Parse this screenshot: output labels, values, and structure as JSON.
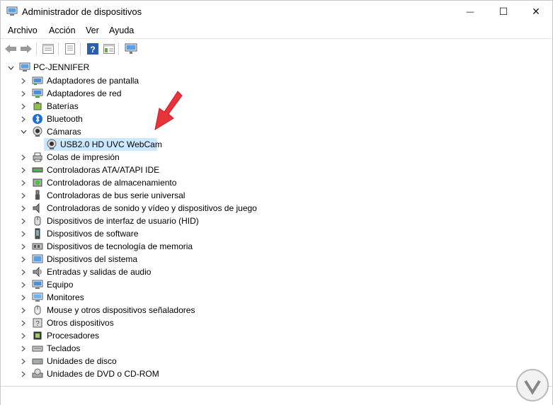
{
  "window": {
    "title": "Administrador de dispositivos",
    "minimize_glyph": "—",
    "maximize_glyph": "☐",
    "close_glyph": "✕"
  },
  "menu": {
    "file": "Archivo",
    "action": "Acción",
    "view": "Ver",
    "help": "Ayuda"
  },
  "tree": {
    "root": "PC-JENNIFER",
    "categories": [
      {
        "label": "Adaptadores de pantalla",
        "icon": "display-adapter-icon",
        "expanded": false
      },
      {
        "label": "Adaptadores de red",
        "icon": "network-adapter-icon",
        "expanded": false
      },
      {
        "label": "Baterías",
        "icon": "battery-icon",
        "expanded": false
      },
      {
        "label": "Bluetooth",
        "icon": "bluetooth-icon",
        "expanded": false
      },
      {
        "label": "Cámaras",
        "icon": "camera-icon",
        "expanded": true,
        "children": [
          {
            "label": "USB2.0 HD UVC WebCam",
            "icon": "webcam-icon",
            "selected": true
          }
        ]
      },
      {
        "label": "Colas de impresión",
        "icon": "printer-icon",
        "expanded": false
      },
      {
        "label": "Controladoras ATA/ATAPI IDE",
        "icon": "ide-controller-icon",
        "expanded": false
      },
      {
        "label": "Controladoras de almacenamiento",
        "icon": "storage-controller-icon",
        "expanded": false
      },
      {
        "label": "Controladoras de bus serie universal",
        "icon": "usb-icon",
        "expanded": false
      },
      {
        "label": "Controladoras de sonido y vídeo y dispositivos de juego",
        "icon": "speaker-icon",
        "expanded": false
      },
      {
        "label": "Dispositivos de interfaz de usuario (HID)",
        "icon": "hid-icon",
        "expanded": false
      },
      {
        "label": "Dispositivos de software",
        "icon": "software-device-icon",
        "expanded": false
      },
      {
        "label": "Dispositivos de tecnología de memoria",
        "icon": "memory-icon",
        "expanded": false
      },
      {
        "label": "Dispositivos del sistema",
        "icon": "system-device-icon",
        "expanded": false
      },
      {
        "label": "Entradas y salidas de audio",
        "icon": "audio-io-icon",
        "expanded": false
      },
      {
        "label": "Equipo",
        "icon": "computer-icon",
        "expanded": false
      },
      {
        "label": "Monitores",
        "icon": "monitor-icon",
        "expanded": false
      },
      {
        "label": "Mouse y otros dispositivos señaladores",
        "icon": "mouse-icon",
        "expanded": false
      },
      {
        "label": "Otros dispositivos",
        "icon": "other-devices-icon",
        "expanded": false
      },
      {
        "label": "Procesadores",
        "icon": "processor-icon",
        "expanded": false
      },
      {
        "label": "Teclados",
        "icon": "keyboard-icon",
        "expanded": false
      },
      {
        "label": "Unidades de disco",
        "icon": "disk-drive-icon",
        "expanded": false
      },
      {
        "label": "Unidades de DVD o CD-ROM",
        "icon": "dvd-drive-icon",
        "expanded": false
      }
    ]
  },
  "colors": {
    "selection": "#cce8ff",
    "annotation_arrow": "#e8333a",
    "help_icon": "#2b5fad"
  }
}
